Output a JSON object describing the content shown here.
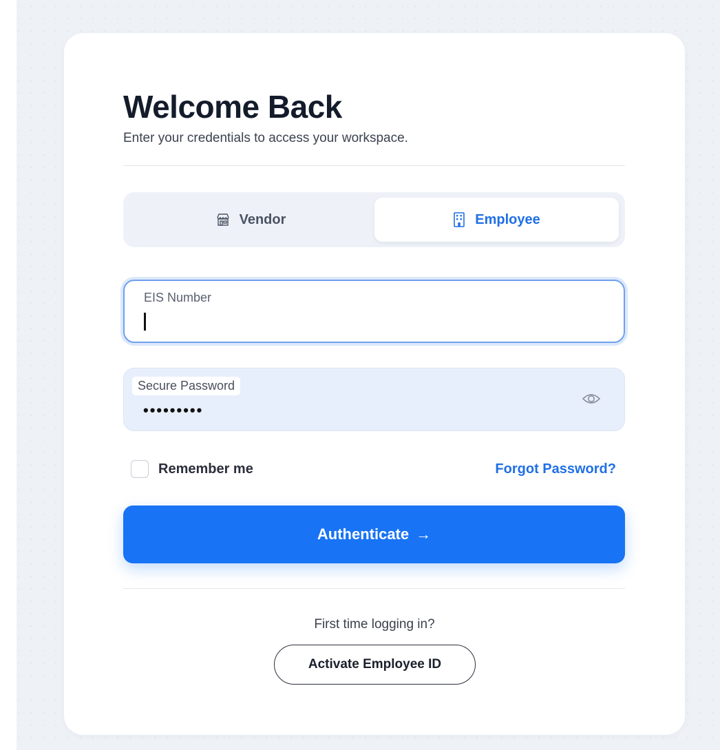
{
  "header": {
    "title": "Welcome Back",
    "subtitle": "Enter your credentials to access your workspace."
  },
  "role_toggle": {
    "options": [
      {
        "label": "Vendor",
        "icon": "store-icon",
        "selected": false
      },
      {
        "label": "Employee",
        "icon": "building-icon",
        "selected": true
      }
    ]
  },
  "form": {
    "eis_label": "EIS Number",
    "eis_value": "",
    "password_label": "Secure Password",
    "password_value": "•••••••••",
    "password_toggle_icon": "eye-icon"
  },
  "options": {
    "remember_label": "Remember me",
    "remember_checked": false,
    "forgot_label": "Forgot Password?"
  },
  "submit": {
    "label": "Authenticate",
    "arrow": "→"
  },
  "footer": {
    "prompt": "First time logging in?",
    "activate_label": "Activate Employee ID"
  },
  "colors": {
    "accent": "#1873f5",
    "link": "#1f6fe5",
    "title": "#141b2b",
    "background": "#eef2f7"
  }
}
